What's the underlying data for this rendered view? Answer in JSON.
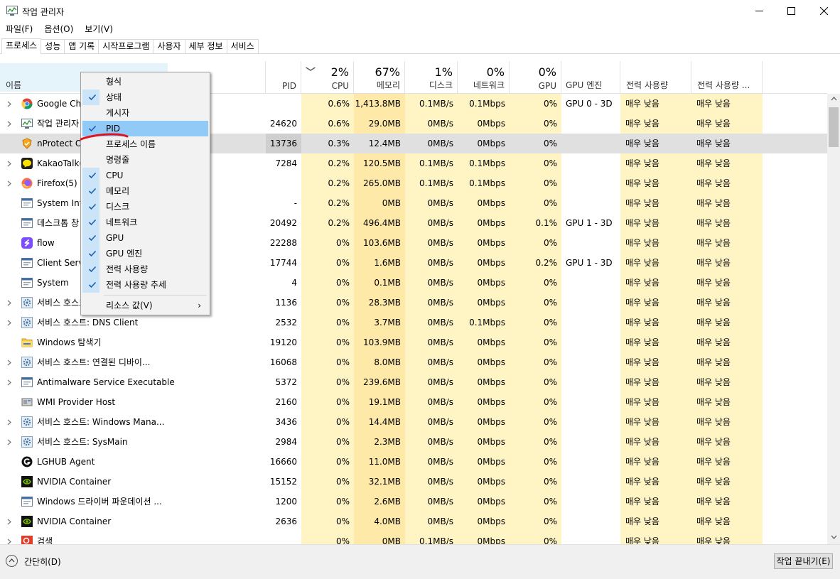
{
  "window": {
    "title": "작업 관리자",
    "minimize": "—",
    "maximize": "☐",
    "close": "✕"
  },
  "menubar": [
    "파일(F)",
    "옵션(O)",
    "보기(V)"
  ],
  "tabs": [
    "프로세스",
    "성능",
    "앱 기록",
    "시작프로그램",
    "사용자",
    "세부 정보",
    "서비스"
  ],
  "header": {
    "name": "이름",
    "pid": "PID",
    "cpu_pct": "2%",
    "cpu": "CPU",
    "mem_pct": "67%",
    "mem": "메모리",
    "disk_pct": "1%",
    "disk": "디스크",
    "net_pct": "0%",
    "net": "네트워크",
    "gpu_pct": "0%",
    "gpu": "GPU",
    "gpu_engine": "GPU 엔진",
    "power": "전력 사용량",
    "power_trend": "전력 사용량 ..."
  },
  "rows": [
    {
      "expand": true,
      "icon": "chrome",
      "name": "Google Chrome",
      "pid": "",
      "cpu": "0.6%",
      "mem": "1,413.8MB",
      "disk": "0.1MB/s",
      "net": "0.1Mbps",
      "gpu": "0%",
      "gpu_engine": "GPU 0 - 3D",
      "power": "매우 낮음",
      "power_trend": "매우 낮음"
    },
    {
      "expand": true,
      "icon": "taskmgr",
      "name": "작업 관리자",
      "pid": "24620",
      "cpu": "0.6%",
      "mem": "29.0MB",
      "disk": "0MB/s",
      "net": "0Mbps",
      "gpu": "0%",
      "gpu_engine": "",
      "power": "매우 낮음",
      "power_trend": "매우 낮음"
    },
    {
      "expand": false,
      "icon": "nprotect",
      "name": "nProtect Online Security",
      "pid": "13736",
      "cpu": "0.3%",
      "mem": "12.4MB",
      "disk": "0MB/s",
      "net": "0Mbps",
      "gpu": "0%",
      "gpu_engine": "",
      "power": "매우 낮음",
      "power_trend": "매우 낮음"
    },
    {
      "expand": true,
      "icon": "kakao",
      "name": "KakaoTalk(3)",
      "pid": "7284",
      "cpu": "0.2%",
      "mem": "120.5MB",
      "disk": "0.1MB/s",
      "net": "0.1Mbps",
      "gpu": "0%",
      "gpu_engine": "",
      "power": "매우 낮음",
      "power_trend": "매우 낮음"
    },
    {
      "expand": true,
      "icon": "firefox",
      "name": "Firefox(5)",
      "pid": "",
      "cpu": "0.2%",
      "mem": "265.0MB",
      "disk": "0.1MB/s",
      "net": "0.1Mbps",
      "gpu": "0%",
      "gpu_engine": "",
      "power": "매우 낮음",
      "power_trend": "매우 낮음"
    },
    {
      "expand": false,
      "icon": "sys",
      "name": "System Interrupts",
      "pid": "-",
      "cpu": "0.2%",
      "mem": "0MB",
      "disk": "0MB/s",
      "net": "0Mbps",
      "gpu": "0%",
      "gpu_engine": "",
      "power": "매우 낮음",
      "power_trend": "매우 낮음"
    },
    {
      "expand": false,
      "icon": "sys",
      "name": "데스크톱 창 관리자",
      "pid": "20492",
      "cpu": "0.2%",
      "mem": "496.4MB",
      "disk": "0MB/s",
      "net": "0Mbps",
      "gpu": "0.1%",
      "gpu_engine": "GPU 1 - 3D",
      "power": "매우 낮음",
      "power_trend": "매우 낮음"
    },
    {
      "expand": false,
      "icon": "flow",
      "name": "flow",
      "pid": "22288",
      "cpu": "0%",
      "mem": "103.6MB",
      "disk": "0MB/s",
      "net": "0Mbps",
      "gpu": "0%",
      "gpu_engine": "",
      "power": "매우 낮음",
      "power_trend": "매우 낮음"
    },
    {
      "expand": false,
      "icon": "sys",
      "name": "Client Server Runtime Process",
      "pid": "17744",
      "cpu": "0%",
      "mem": "1.6MB",
      "disk": "0MB/s",
      "net": "0Mbps",
      "gpu": "0.2%",
      "gpu_engine": "GPU 1 - 3D",
      "power": "매우 낮음",
      "power_trend": "매우 낮음"
    },
    {
      "expand": false,
      "icon": "sys",
      "name": "System",
      "pid": "4",
      "cpu": "0%",
      "mem": "0.1MB",
      "disk": "0MB/s",
      "net": "0Mbps",
      "gpu": "0%",
      "gpu_engine": "",
      "power": "매우 낮음",
      "power_trend": "매우 낮음"
    },
    {
      "expand": true,
      "icon": "gear",
      "name": "서비스 호스트: 로컬 시스템",
      "pid": "1136",
      "cpu": "0%",
      "mem": "28.3MB",
      "disk": "0MB/s",
      "net": "0Mbps",
      "gpu": "0%",
      "gpu_engine": "",
      "power": "매우 낮음",
      "power_trend": "매우 낮음"
    },
    {
      "expand": true,
      "icon": "gear",
      "name": "서비스 호스트: DNS Client",
      "pid": "2532",
      "cpu": "0%",
      "mem": "3.7MB",
      "disk": "0MB/s",
      "net": "0.1Mbps",
      "gpu": "0%",
      "gpu_engine": "",
      "power": "매우 낮음",
      "power_trend": "매우 낮음"
    },
    {
      "expand": false,
      "icon": "folder",
      "name": "Windows 탐색기",
      "pid": "19120",
      "cpu": "0%",
      "mem": "103.9MB",
      "disk": "0MB/s",
      "net": "0Mbps",
      "gpu": "0%",
      "gpu_engine": "",
      "power": "매우 낮음",
      "power_trend": "매우 낮음"
    },
    {
      "expand": true,
      "icon": "gear",
      "name": "서비스 호스트: 연결된 디바이...",
      "pid": "16068",
      "cpu": "0%",
      "mem": "8.0MB",
      "disk": "0MB/s",
      "net": "0Mbps",
      "gpu": "0%",
      "gpu_engine": "",
      "power": "매우 낮음",
      "power_trend": "매우 낮음"
    },
    {
      "expand": true,
      "icon": "sys",
      "name": "Antimalware Service Executable",
      "pid": "5372",
      "cpu": "0%",
      "mem": "239.6MB",
      "disk": "0MB/s",
      "net": "0Mbps",
      "gpu": "0%",
      "gpu_engine": "",
      "power": "매우 낮음",
      "power_trend": "매우 낮음"
    },
    {
      "expand": false,
      "icon": "wmi",
      "name": "WMI Provider Host",
      "pid": "2160",
      "cpu": "0%",
      "mem": "19.1MB",
      "disk": "0MB/s",
      "net": "0Mbps",
      "gpu": "0%",
      "gpu_engine": "",
      "power": "매우 낮음",
      "power_trend": "매우 낮음"
    },
    {
      "expand": true,
      "icon": "gear",
      "name": "서비스 호스트: Windows Mana...",
      "pid": "3436",
      "cpu": "0%",
      "mem": "14.4MB",
      "disk": "0MB/s",
      "net": "0Mbps",
      "gpu": "0%",
      "gpu_engine": "",
      "power": "매우 낮음",
      "power_trend": "매우 낮음"
    },
    {
      "expand": true,
      "icon": "gear",
      "name": "서비스 호스트: SysMain",
      "pid": "2984",
      "cpu": "0%",
      "mem": "2.3MB",
      "disk": "0MB/s",
      "net": "0Mbps",
      "gpu": "0%",
      "gpu_engine": "",
      "power": "매우 낮음",
      "power_trend": "매우 낮음"
    },
    {
      "expand": false,
      "icon": "lghub",
      "name": "LGHUB Agent",
      "pid": "16660",
      "cpu": "0%",
      "mem": "11.0MB",
      "disk": "0MB/s",
      "net": "0Mbps",
      "gpu": "0%",
      "gpu_engine": "",
      "power": "매우 낮음",
      "power_trend": "매우 낮음"
    },
    {
      "expand": false,
      "icon": "nvidia",
      "name": "NVIDIA Container",
      "pid": "15152",
      "cpu": "0%",
      "mem": "32.1MB",
      "disk": "0MB/s",
      "net": "0Mbps",
      "gpu": "0%",
      "gpu_engine": "",
      "power": "매우 낮음",
      "power_trend": "매우 낮음"
    },
    {
      "expand": false,
      "icon": "sys",
      "name": "Windows 드라이버 파운데이션 ...",
      "pid": "1200",
      "cpu": "0%",
      "mem": "2.6MB",
      "disk": "0MB/s",
      "net": "0Mbps",
      "gpu": "0%",
      "gpu_engine": "",
      "power": "매우 낮음",
      "power_trend": "매우 낮음"
    },
    {
      "expand": true,
      "icon": "nvidia",
      "name": "NVIDIA Container",
      "pid": "2636",
      "cpu": "0%",
      "mem": "4.0MB",
      "disk": "0MB/s",
      "net": "0Mbps",
      "gpu": "0%",
      "gpu_engine": "",
      "power": "매우 낮음",
      "power_trend": "매우 낮음"
    },
    {
      "expand": true,
      "icon": "search",
      "name": "검색",
      "pid": "",
      "cpu": "0%",
      "mem": "0MB",
      "disk": "0.1MB/s",
      "net": "0Mbps",
      "gpu": "0%",
      "gpu_engine": "",
      "power": "매우 낮음",
      "power_trend": "매우 낮음"
    }
  ],
  "context_menu": {
    "items": [
      {
        "label": "형식",
        "checked": false
      },
      {
        "label": "상태",
        "checked": true
      },
      {
        "label": "게시자",
        "checked": false
      },
      {
        "label": "PID",
        "checked": true,
        "highlighted": true
      },
      {
        "label": "프로세스 이름",
        "checked": false
      },
      {
        "label": "명령줄",
        "checked": false
      },
      {
        "label": "CPU",
        "checked": true
      },
      {
        "label": "메모리",
        "checked": true
      },
      {
        "label": "디스크",
        "checked": true
      },
      {
        "label": "네트워크",
        "checked": true
      },
      {
        "label": "GPU",
        "checked": true
      },
      {
        "label": "GPU 엔진",
        "checked": true
      },
      {
        "label": "전력 사용량",
        "checked": true
      },
      {
        "label": "전력 사용량 추세",
        "checked": true
      }
    ],
    "submenu": {
      "label": "리소스 값(V)",
      "arrow": "›"
    }
  },
  "footer": {
    "fewer_details": "간단히(D)",
    "end_task": "작업 끝내기(E)"
  },
  "colors": {
    "cpu_bg": "#fff4c4",
    "mem_bg": "#ffe9a8",
    "light_bg": "#fff4c4",
    "selected_row": "#e0e0e0",
    "menu_highlight": "#91c9f7",
    "annotation": "#e0141e"
  }
}
